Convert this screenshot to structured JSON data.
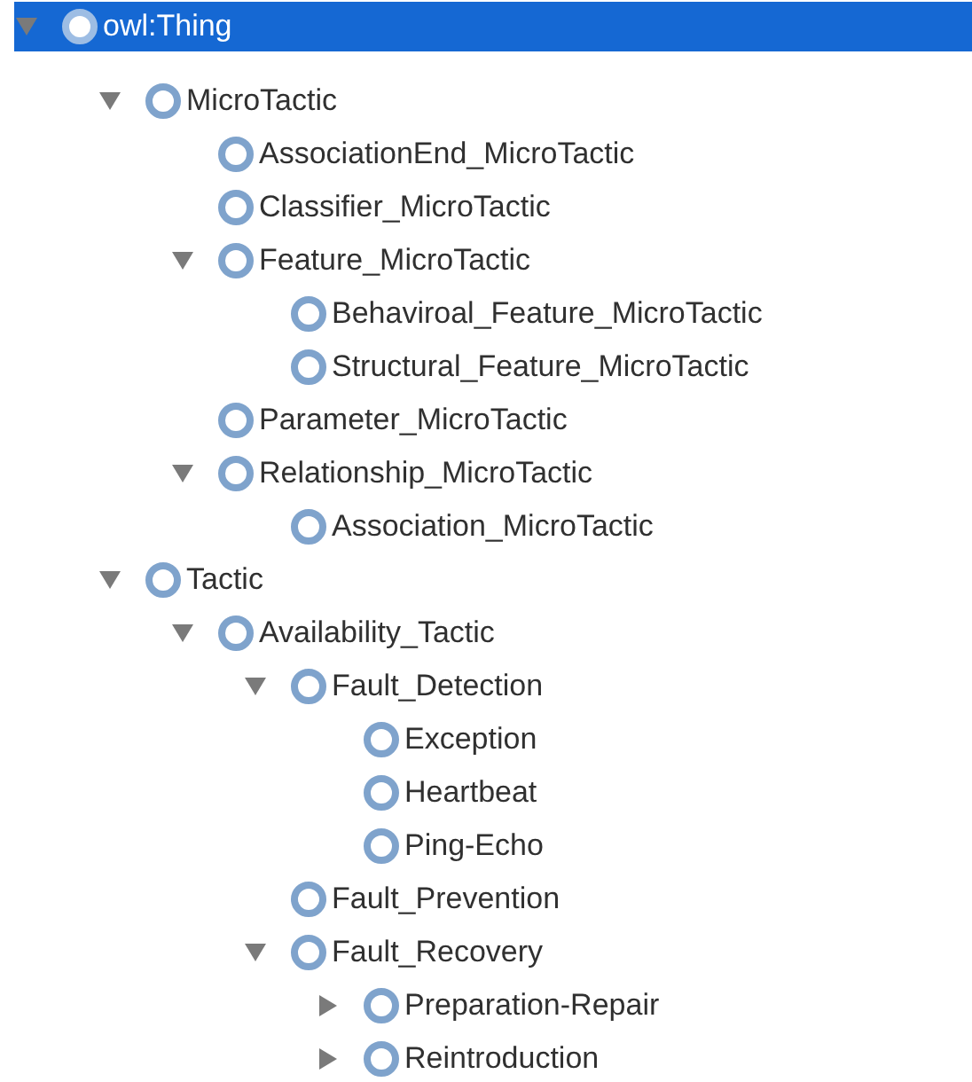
{
  "tree": [
    {
      "label": "owl:Thing",
      "selected": true,
      "expanded": true,
      "children": [
        {
          "label": "MicroTactic",
          "selected": false,
          "expanded": true,
          "children": [
            {
              "label": "AssociationEnd_MicroTactic",
              "selected": false
            },
            {
              "label": "Classifier_MicroTactic",
              "selected": false
            },
            {
              "label": "Feature_MicroTactic",
              "selected": false,
              "expanded": true,
              "children": [
                {
                  "label": "Behaviroal_Feature_MicroTactic",
                  "selected": false
                },
                {
                  "label": "Structural_Feature_MicroTactic",
                  "selected": false
                }
              ]
            },
            {
              "label": "Parameter_MicroTactic",
              "selected": false
            },
            {
              "label": "Relationship_MicroTactic",
              "selected": false,
              "expanded": true,
              "children": [
                {
                  "label": "Association_MicroTactic",
                  "selected": false
                }
              ]
            }
          ]
        },
        {
          "label": "Tactic",
          "selected": false,
          "expanded": true,
          "children": [
            {
              "label": "Availability_Tactic",
              "selected": false,
              "expanded": true,
              "children": [
                {
                  "label": "Fault_Detection",
                  "selected": false,
                  "expanded": true,
                  "children": [
                    {
                      "label": "Exception",
                      "selected": false
                    },
                    {
                      "label": "Heartbeat",
                      "selected": false
                    },
                    {
                      "label": "Ping-Echo",
                      "selected": false
                    }
                  ]
                },
                {
                  "label": "Fault_Prevention",
                  "selected": false
                },
                {
                  "label": "Fault_Recovery",
                  "selected": false,
                  "expanded": true,
                  "children": [
                    {
                      "label": "Preparation-Repair",
                      "selected": false,
                      "expanded": false
                    },
                    {
                      "label": "Reintroduction",
                      "selected": false,
                      "expanded": false
                    }
                  ]
                }
              ]
            }
          ]
        }
      ]
    }
  ]
}
